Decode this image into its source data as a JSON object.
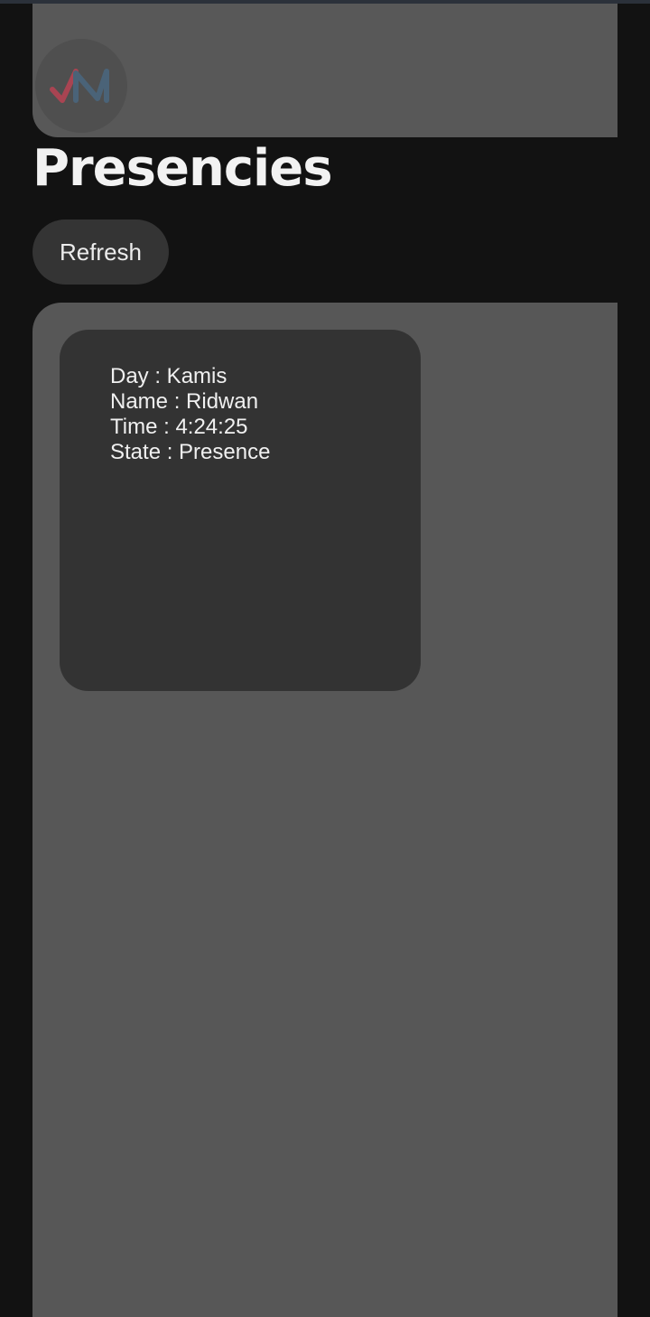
{
  "app": {
    "logo_icon": "vm-logo-icon"
  },
  "page": {
    "title": "Presencies"
  },
  "toolbar": {
    "refresh_label": "Refresh"
  },
  "presences": [
    {
      "day_label": "Day : Kamis",
      "name_label": "Name : Ridwan",
      "time_label": "Time : 4:24:25",
      "state_label": "State : Presence"
    }
  ],
  "colors": {
    "background": "#121212",
    "header_panel": "#585858",
    "content_panel": "#575757",
    "card": "#333333",
    "button": "#343434",
    "logo_red": "#a94452",
    "logo_blue": "#4a6378"
  }
}
